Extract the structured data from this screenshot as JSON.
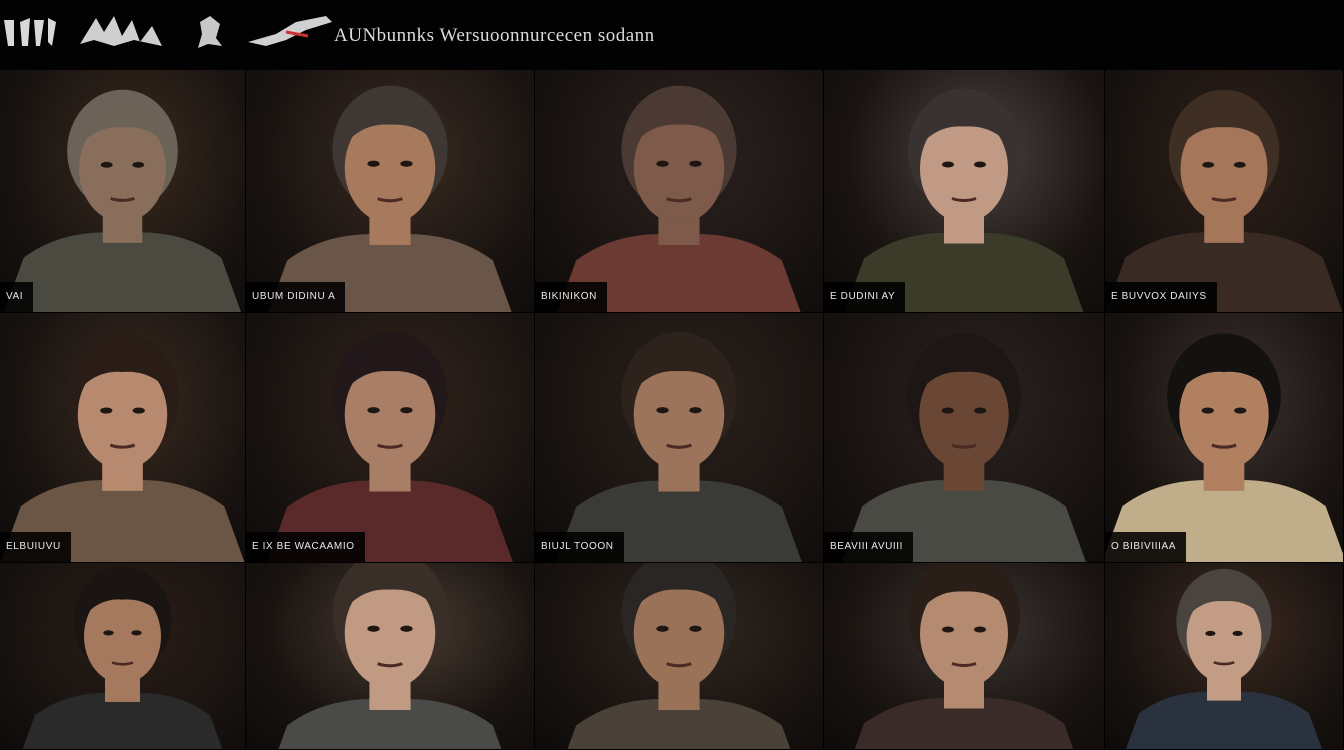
{
  "header": {
    "title": "AUNbunnks  Wersuoonnurcecen sodann",
    "logos": [
      "brand-logo-1",
      "brand-logo-2",
      "brand-logo-3",
      "brand-logo-4"
    ]
  },
  "characters": [
    {
      "name": "VAI",
      "skin": "#8a6e5c",
      "hair": "#6b6258",
      "outfit": "#4a4a40",
      "bg": "#3a2a1f"
    },
    {
      "name": "UBUM DIDINU A",
      "skin": "#a77a5e",
      "hair": "#3e3733",
      "outfit": "#6a5648",
      "bg": "#3b2b22"
    },
    {
      "name": "BIKINIKON",
      "skin": "#7d5a49",
      "hair": "#4a3a33",
      "outfit": "#6b3a33",
      "bg": "#2c2220"
    },
    {
      "name": "E DUDINI AY",
      "skin": "#c09a84",
      "hair": "#3a3230",
      "outfit": "#3b3b2a",
      "bg": "#4a4240"
    },
    {
      "name": "E BUVVOX DAIIYS",
      "skin": "#a6765a",
      "hair": "#3e2e24",
      "outfit": "#3a2a24",
      "bg": "#2e1f18"
    },
    {
      "name": "ELBUIUVU",
      "skin": "#b78a70",
      "hair": "#2a1c17",
      "outfit": "#6b5544",
      "bg": "#3a2a20"
    },
    {
      "name": "E IX BE WACAAMIO",
      "skin": "#a97e66",
      "hair": "#22181a",
      "outfit": "#5a2a2a",
      "bg": "#33241c"
    },
    {
      "name": "BIUJL TOOON",
      "skin": "#9c735b",
      "hair": "#2e221c",
      "outfit": "#3a3a36",
      "bg": "#2a201c"
    },
    {
      "name": "BEAVIII AVUIII",
      "skin": "#6a4635",
      "hair": "#1c1614",
      "outfit": "#4a4a44",
      "bg": "#2a2220"
    },
    {
      "name": "O BIBIVIIIAA",
      "skin": "#b08060",
      "hair": "#141210",
      "outfit": "#c0ae8a",
      "bg": "#3a3230"
    },
    {
      "name": "",
      "skin": "#a5795e",
      "hair": "#1a1412",
      "outfit": "#2a2a2a",
      "bg": "#2a1c16"
    },
    {
      "name": "",
      "skin": "#c09a82",
      "hair": "#3a2e28",
      "outfit": "#4a4a48",
      "bg": "#4a3c32"
    },
    {
      "name": "",
      "skin": "#9a7258",
      "hair": "#2a2624",
      "outfit": "#4a4238",
      "bg": "#2e2620"
    },
    {
      "name": "",
      "skin": "#b48a70",
      "hair": "#2a1e18",
      "outfit": "#3a2a28",
      "bg": "#3a3432"
    },
    {
      "name": "",
      "skin": "#c29c84",
      "hair": "#4a4440",
      "outfit": "#2a3240",
      "bg": "#3e2a20"
    }
  ]
}
